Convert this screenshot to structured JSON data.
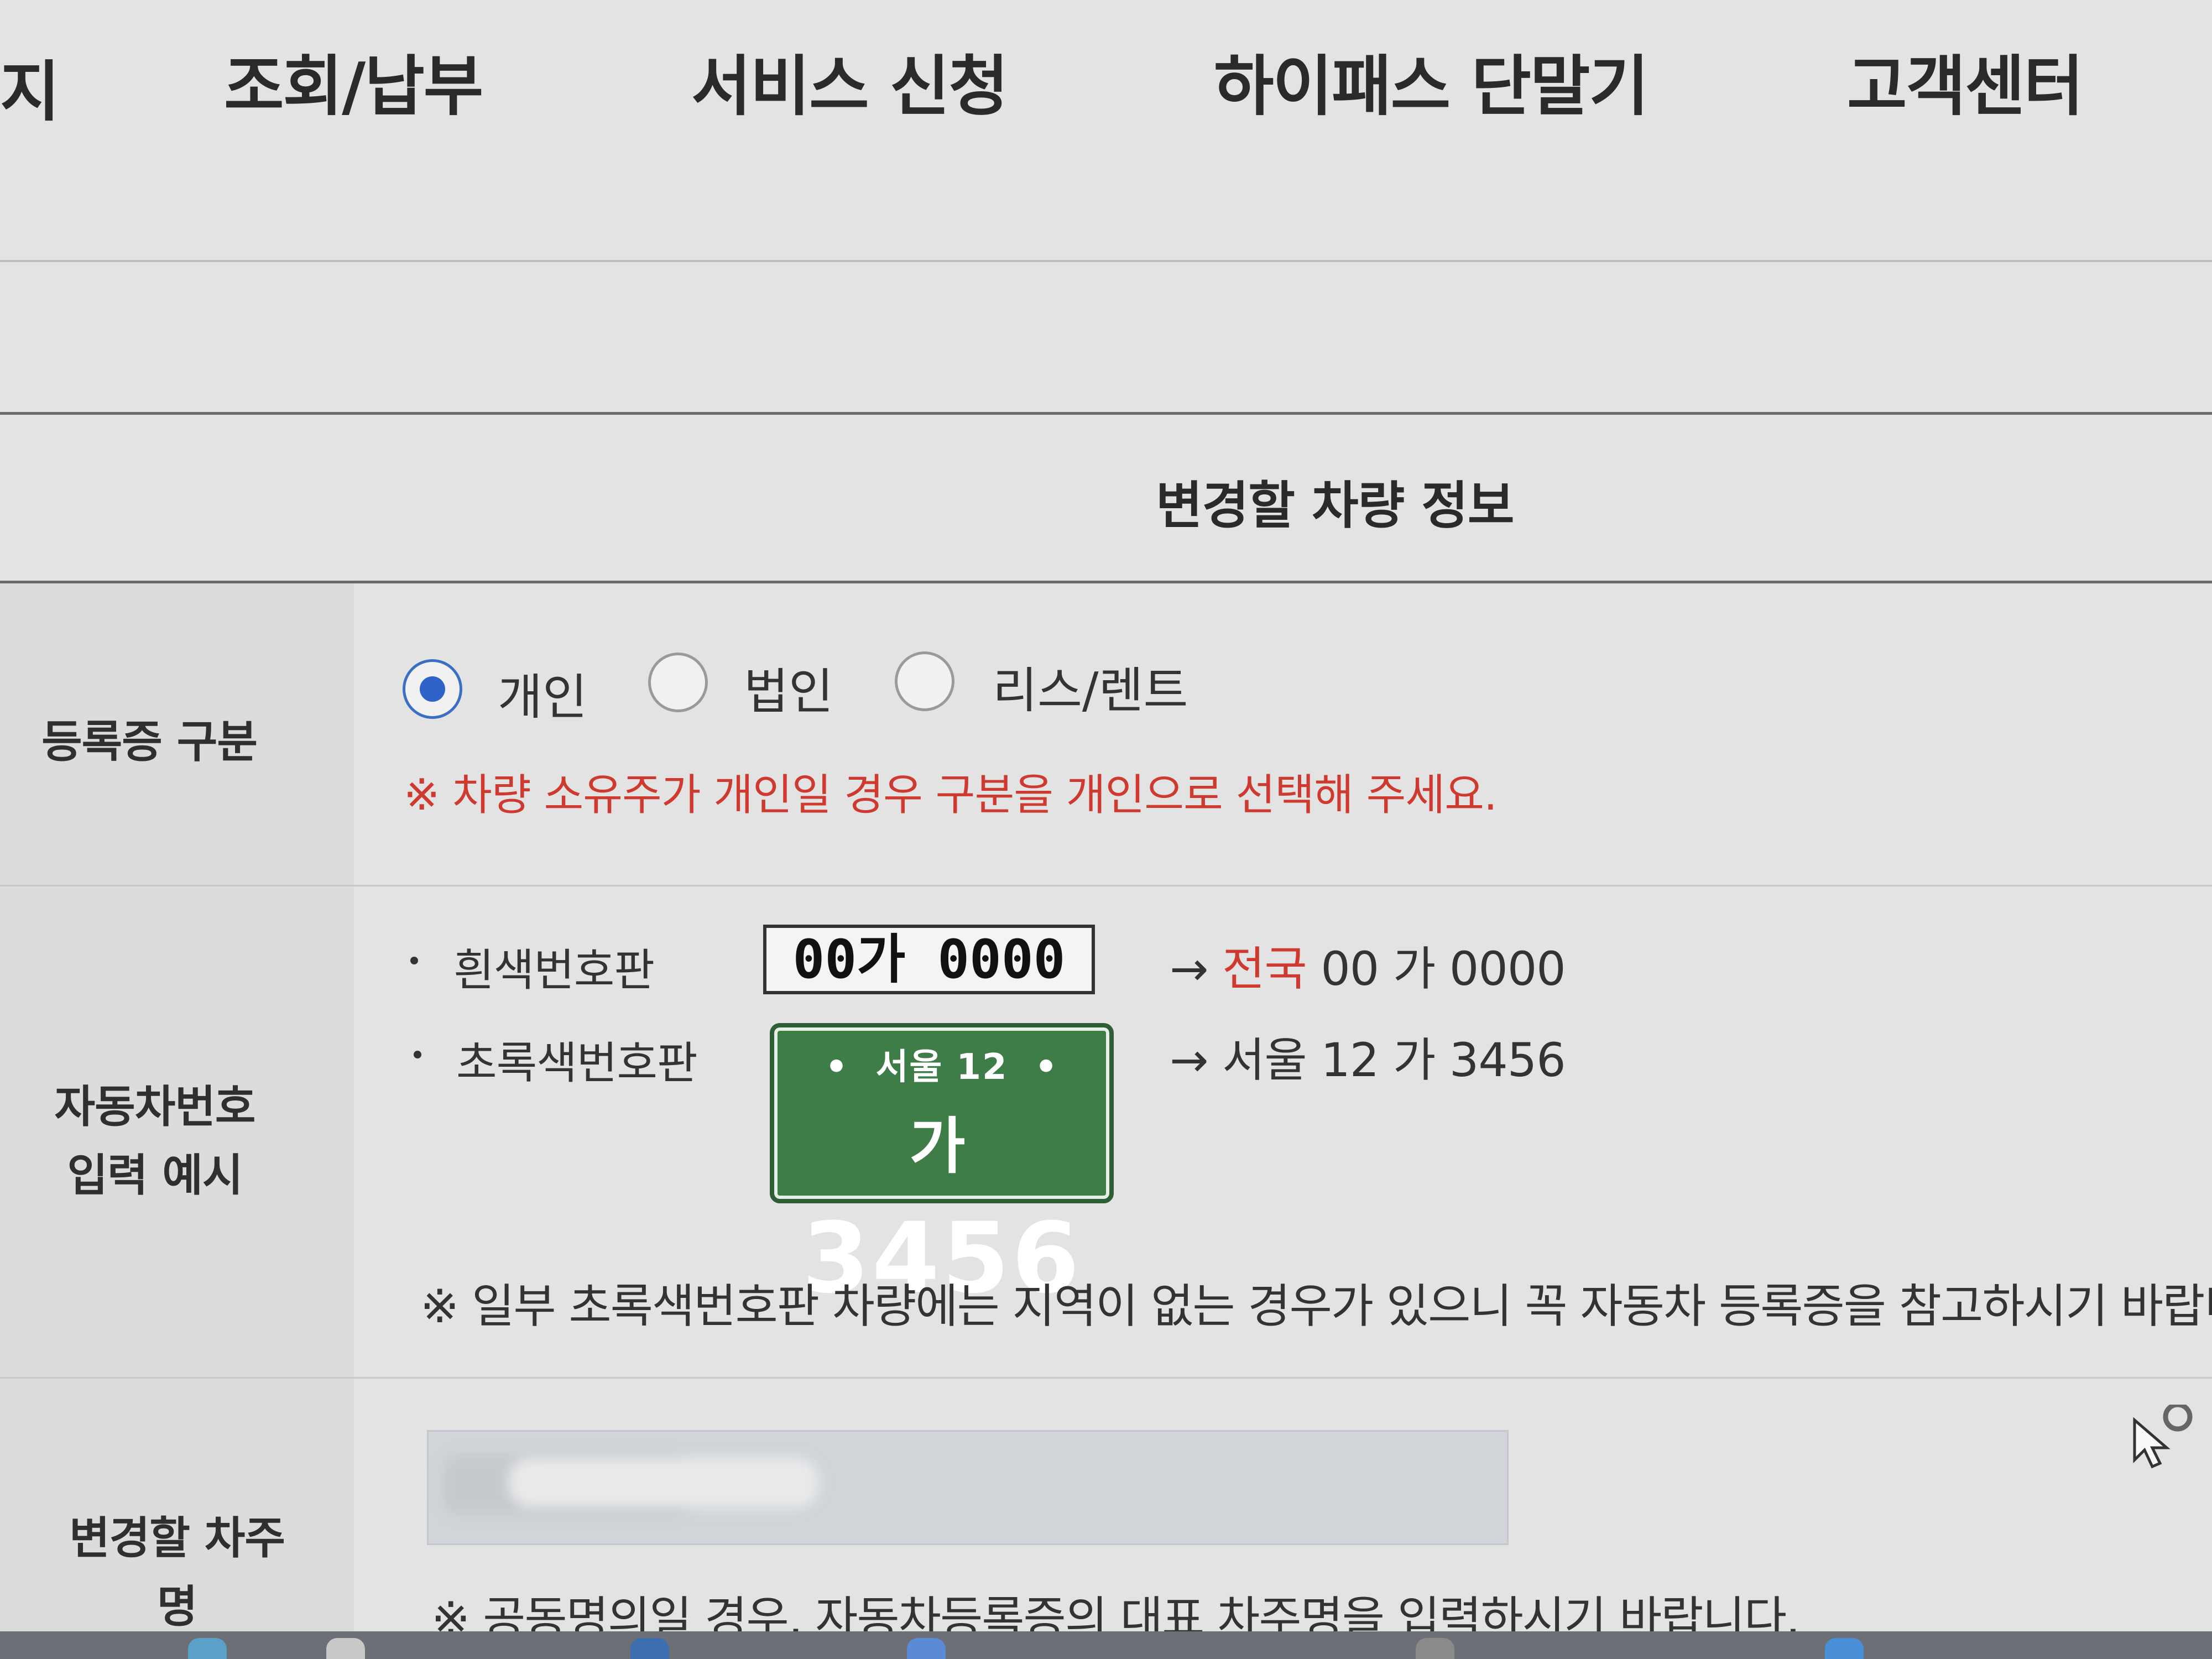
{
  "nav": {
    "partial": "지",
    "items": [
      "조회/납부",
      "서비스 신청",
      "하이패스 단말기",
      "고객센터"
    ]
  },
  "section_title": "변경할 차량 정보",
  "registration_type": {
    "label": "등록증 구분",
    "options": [
      {
        "label": "개인",
        "checked": true
      },
      {
        "label": "법인",
        "checked": false
      },
      {
        "label": "리스/렌트",
        "checked": false
      }
    ],
    "warning": "※ 차량 소유주가 개인일 경우 구분을 개인으로 선택해 주세요."
  },
  "plate_example": {
    "label_line1": "자동차번호",
    "label_line2": "입력 예시",
    "white": {
      "label": "흰색번호판",
      "plate_text": "00가 0000",
      "arrow": "→",
      "result_red": "전국",
      "result_rest": "00 가 0000"
    },
    "green": {
      "label": "초록색번호판",
      "plate_top": "서울 12",
      "plate_hangul": "가",
      "plate_number": "3456",
      "arrow": "→",
      "result": "서울 12 가 3456"
    },
    "note": "※ 일부 초록색번호판 차량에는 지역이 없는 경우가 있으니 꼭 자동차 등록증을 참고하시기 바랍니다."
  },
  "owner": {
    "label": "변경할 차주명",
    "value": "",
    "note": "※ 공동명의일 경우, 자동차등록증의 대표 차주명을 입력하시기 바랍니다."
  },
  "colors": {
    "accent_blue": "#2f63c7",
    "warning_red": "#cf3a30",
    "plate_green": "#3f7d48"
  }
}
